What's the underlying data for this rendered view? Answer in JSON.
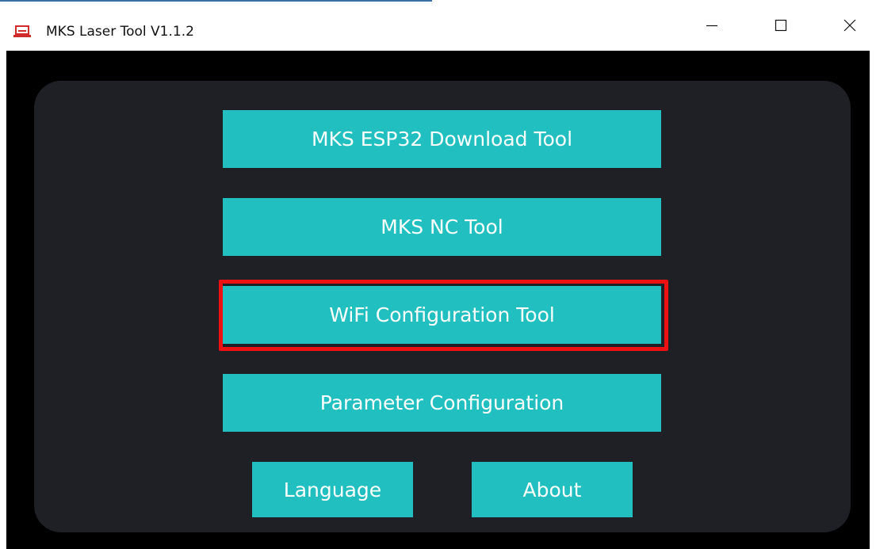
{
  "window": {
    "title": "MKS Laser Tool V1.1.2",
    "icons": {
      "app": "laptop-icon",
      "minimize": "minimize-icon",
      "maximize": "maximize-icon",
      "close": "close-icon"
    }
  },
  "menu": {
    "buttons": [
      {
        "id": "esp32",
        "label": "MKS ESP32 Download Tool"
      },
      {
        "id": "nc",
        "label": "MKS NC Tool"
      },
      {
        "id": "wifi",
        "label": "WiFi Configuration Tool",
        "highlighted": true
      },
      {
        "id": "param",
        "label": "Parameter Configuration"
      },
      {
        "id": "language",
        "label": "Language"
      },
      {
        "id": "about",
        "label": "About"
      }
    ]
  },
  "colors": {
    "button_bg": "#21bfbf",
    "button_text": "#ffffff",
    "panel_bg": "#1f2026",
    "client_bg": "#000000",
    "highlight": "#ee1111",
    "app_icon": "#d22b2b"
  }
}
